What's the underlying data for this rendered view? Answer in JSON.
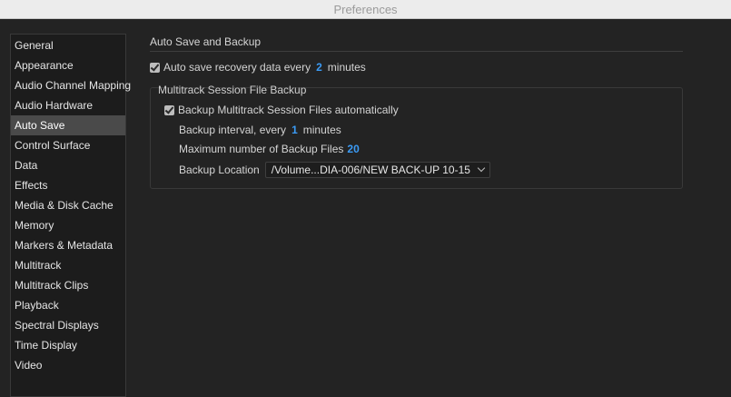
{
  "window": {
    "title": "Preferences"
  },
  "sidebar": {
    "selected": "Auto Save",
    "items": [
      {
        "label": "General"
      },
      {
        "label": "Appearance"
      },
      {
        "label": "Audio Channel Mapping"
      },
      {
        "label": "Audio Hardware"
      },
      {
        "label": "Auto Save"
      },
      {
        "label": "Control Surface"
      },
      {
        "label": "Data"
      },
      {
        "label": "Effects"
      },
      {
        "label": "Media & Disk Cache"
      },
      {
        "label": "Memory"
      },
      {
        "label": "Markers & Metadata"
      },
      {
        "label": "Multitrack"
      },
      {
        "label": "Multitrack Clips"
      },
      {
        "label": "Playback"
      },
      {
        "label": "Spectral Displays"
      },
      {
        "label": "Time Display"
      },
      {
        "label": "Video"
      }
    ]
  },
  "auto_save": {
    "section_title": "Auto Save and Backup",
    "recovery": {
      "checked": true,
      "label": "Auto save recovery data every",
      "value": "2",
      "unit": "minutes"
    },
    "multitrack": {
      "group_title": "Multitrack Session File Backup",
      "backup_auto": {
        "checked": true,
        "label": "Backup Multitrack Session Files automatically"
      },
      "interval": {
        "label": "Backup interval, every",
        "value": "1",
        "unit": "minutes"
      },
      "max_files": {
        "label": "Maximum number of Backup Files",
        "value": "20"
      },
      "location": {
        "label": "Backup Location",
        "value": "/Volume...DIA-006/NEW BACK-UP 10-15"
      }
    }
  },
  "colors": {
    "accent_value": "#3b9bf5",
    "selected_item": "#4a4a4a",
    "background": "#232323"
  }
}
